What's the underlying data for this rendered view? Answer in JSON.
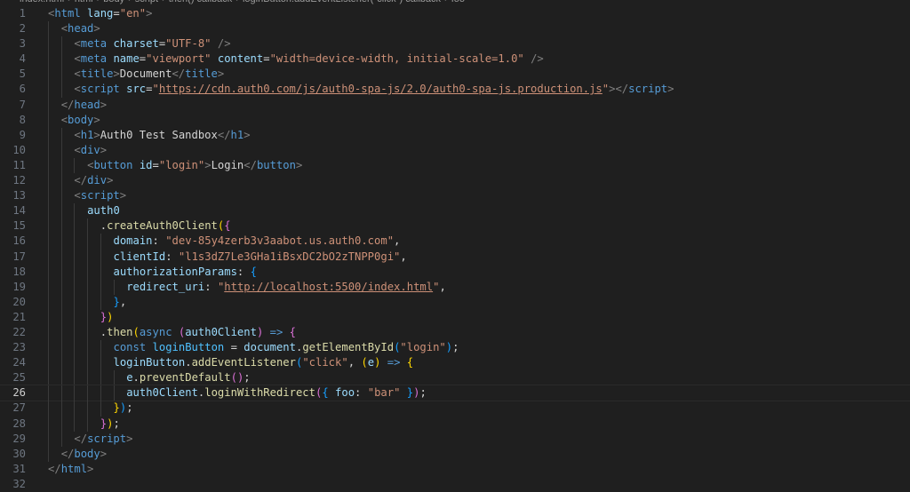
{
  "breadcrumb": [
    "index.html",
    "html",
    "body",
    "script",
    "then() callback",
    "loginButton.addEventListener(\"click\") callback",
    "foo"
  ],
  "active_line": 26,
  "lines": [
    {
      "n": "1",
      "indent": 0,
      "tokens": [
        [
          "ang",
          "<"
        ],
        [
          "tag",
          "html"
        ],
        [
          "text",
          " "
        ],
        [
          "attr",
          "lang"
        ],
        [
          "eq",
          "="
        ],
        [
          "str",
          "\"en\""
        ],
        [
          "ang",
          ">"
        ]
      ]
    },
    {
      "n": "2",
      "indent": 1,
      "tokens": [
        [
          "ang",
          "<"
        ],
        [
          "tag",
          "head"
        ],
        [
          "ang",
          ">"
        ]
      ]
    },
    {
      "n": "3",
      "indent": 2,
      "tokens": [
        [
          "ang",
          "<"
        ],
        [
          "tag",
          "meta"
        ],
        [
          "text",
          " "
        ],
        [
          "attr",
          "charset"
        ],
        [
          "eq",
          "="
        ],
        [
          "str",
          "\"UTF-8\""
        ],
        [
          "text",
          " "
        ],
        [
          "ang",
          "/>"
        ]
      ]
    },
    {
      "n": "4",
      "indent": 2,
      "tokens": [
        [
          "ang",
          "<"
        ],
        [
          "tag",
          "meta"
        ],
        [
          "text",
          " "
        ],
        [
          "attr",
          "name"
        ],
        [
          "eq",
          "="
        ],
        [
          "str",
          "\"viewport\""
        ],
        [
          "text",
          " "
        ],
        [
          "attr",
          "content"
        ],
        [
          "eq",
          "="
        ],
        [
          "str",
          "\"width=device-width, initial-scale=1.0\""
        ],
        [
          "text",
          " "
        ],
        [
          "ang",
          "/>"
        ]
      ]
    },
    {
      "n": "5",
      "indent": 2,
      "tokens": [
        [
          "ang",
          "<"
        ],
        [
          "tag",
          "title"
        ],
        [
          "ang",
          ">"
        ],
        [
          "text",
          "Document"
        ],
        [
          "ang",
          "</"
        ],
        [
          "tag",
          "title"
        ],
        [
          "ang",
          ">"
        ]
      ]
    },
    {
      "n": "6",
      "indent": 2,
      "tokens": [
        [
          "ang",
          "<"
        ],
        [
          "tag",
          "script"
        ],
        [
          "text",
          " "
        ],
        [
          "attr",
          "src"
        ],
        [
          "eq",
          "="
        ],
        [
          "str",
          "\""
        ],
        [
          "link",
          "https://cdn.auth0.com/js/auth0-spa-js/2.0/auth0-spa-js.production.js"
        ],
        [
          "str",
          "\""
        ],
        [
          "ang",
          "></"
        ],
        [
          "tag",
          "script"
        ],
        [
          "ang",
          ">"
        ]
      ]
    },
    {
      "n": "7",
      "indent": 1,
      "tokens": [
        [
          "ang",
          "</"
        ],
        [
          "tag",
          "head"
        ],
        [
          "ang",
          ">"
        ]
      ]
    },
    {
      "n": "8",
      "indent": 1,
      "tokens": [
        [
          "ang",
          "<"
        ],
        [
          "tag",
          "body"
        ],
        [
          "ang",
          ">"
        ]
      ]
    },
    {
      "n": "9",
      "indent": 2,
      "tokens": [
        [
          "ang",
          "<"
        ],
        [
          "tag",
          "h1"
        ],
        [
          "ang",
          ">"
        ],
        [
          "text",
          "Auth0 Test Sandbox"
        ],
        [
          "ang",
          "</"
        ],
        [
          "tag",
          "h1"
        ],
        [
          "ang",
          ">"
        ]
      ]
    },
    {
      "n": "10",
      "indent": 2,
      "tokens": [
        [
          "ang",
          "<"
        ],
        [
          "tag",
          "div"
        ],
        [
          "ang",
          ">"
        ]
      ]
    },
    {
      "n": "11",
      "indent": 3,
      "tokens": [
        [
          "ang",
          "<"
        ],
        [
          "tag",
          "button"
        ],
        [
          "text",
          " "
        ],
        [
          "attr",
          "id"
        ],
        [
          "eq",
          "="
        ],
        [
          "str",
          "\"login\""
        ],
        [
          "ang",
          ">"
        ],
        [
          "text",
          "Login"
        ],
        [
          "ang",
          "</"
        ],
        [
          "tag",
          "button"
        ],
        [
          "ang",
          ">"
        ]
      ]
    },
    {
      "n": "12",
      "indent": 2,
      "tokens": [
        [
          "ang",
          "</"
        ],
        [
          "tag",
          "div"
        ],
        [
          "ang",
          ">"
        ]
      ]
    },
    {
      "n": "13",
      "indent": 2,
      "tokens": [
        [
          "ang",
          "<"
        ],
        [
          "tag",
          "script"
        ],
        [
          "ang",
          ">"
        ]
      ]
    },
    {
      "n": "14",
      "indent": 3,
      "tokens": [
        [
          "var",
          "auth0"
        ]
      ]
    },
    {
      "n": "15",
      "indent": 4,
      "tokens": [
        [
          "punc",
          "."
        ],
        [
          "fn",
          "createAuth0Client"
        ],
        [
          "b1",
          "("
        ],
        [
          "b2",
          "{"
        ]
      ]
    },
    {
      "n": "16",
      "indent": 5,
      "tokens": [
        [
          "var",
          "domain"
        ],
        [
          "punc",
          ": "
        ],
        [
          "str",
          "\"dev-85y4zerb3v3aabot.us.auth0.com\""
        ],
        [
          "punc",
          ","
        ]
      ]
    },
    {
      "n": "17",
      "indent": 5,
      "tokens": [
        [
          "var",
          "clientId"
        ],
        [
          "punc",
          ": "
        ],
        [
          "str",
          "\"l1s3dZ7Le3GHa1iBsxDC2bO2zTNPP0gi\""
        ],
        [
          "punc",
          ","
        ]
      ]
    },
    {
      "n": "18",
      "indent": 5,
      "tokens": [
        [
          "var",
          "authorizationParams"
        ],
        [
          "punc",
          ": "
        ],
        [
          "b3",
          "{"
        ]
      ]
    },
    {
      "n": "19",
      "indent": 6,
      "tokens": [
        [
          "var",
          "redirect_uri"
        ],
        [
          "punc",
          ": "
        ],
        [
          "str",
          "\""
        ],
        [
          "link",
          "http://localhost:5500/index.html"
        ],
        [
          "str",
          "\""
        ],
        [
          "punc",
          ","
        ]
      ]
    },
    {
      "n": "20",
      "indent": 5,
      "tokens": [
        [
          "b3",
          "}"
        ],
        [
          "punc",
          ","
        ]
      ]
    },
    {
      "n": "21",
      "indent": 4,
      "tokens": [
        [
          "b2",
          "}"
        ],
        [
          "b1",
          ")"
        ]
      ]
    },
    {
      "n": "22",
      "indent": 4,
      "tokens": [
        [
          "punc",
          "."
        ],
        [
          "fn",
          "then"
        ],
        [
          "b1",
          "("
        ],
        [
          "kw",
          "async"
        ],
        [
          "text",
          " "
        ],
        [
          "b2",
          "("
        ],
        [
          "var",
          "auth0Client"
        ],
        [
          "b2",
          ")"
        ],
        [
          "text",
          " "
        ],
        [
          "kw",
          "=>"
        ],
        [
          "text",
          " "
        ],
        [
          "b2",
          "{"
        ]
      ]
    },
    {
      "n": "23",
      "indent": 5,
      "tokens": [
        [
          "kw",
          "const"
        ],
        [
          "text",
          " "
        ],
        [
          "const",
          "loginButton"
        ],
        [
          "text",
          " "
        ],
        [
          "eq",
          "="
        ],
        [
          "text",
          " "
        ],
        [
          "var",
          "document"
        ],
        [
          "punc",
          "."
        ],
        [
          "fn",
          "getElementById"
        ],
        [
          "b3",
          "("
        ],
        [
          "str",
          "\"login\""
        ],
        [
          "b3",
          ")"
        ],
        [
          "punc",
          ";"
        ]
      ]
    },
    {
      "n": "24",
      "indent": 5,
      "tokens": [
        [
          "var",
          "loginButton"
        ],
        [
          "punc",
          "."
        ],
        [
          "fn",
          "addEventListener"
        ],
        [
          "b3",
          "("
        ],
        [
          "str",
          "\"click\""
        ],
        [
          "punc",
          ", "
        ],
        [
          "b1",
          "("
        ],
        [
          "var",
          "e"
        ],
        [
          "b1",
          ")"
        ],
        [
          "text",
          " "
        ],
        [
          "kw",
          "=>"
        ],
        [
          "text",
          " "
        ],
        [
          "b1",
          "{"
        ]
      ]
    },
    {
      "n": "25",
      "indent": 6,
      "tokens": [
        [
          "var",
          "e"
        ],
        [
          "punc",
          "."
        ],
        [
          "fn",
          "preventDefault"
        ],
        [
          "b2",
          "()"
        ],
        [
          "punc",
          ";"
        ]
      ]
    },
    {
      "n": "26",
      "indent": 6,
      "tokens": [
        [
          "var",
          "auth0Client"
        ],
        [
          "punc",
          "."
        ],
        [
          "fn",
          "loginWithRedirect"
        ],
        [
          "b2",
          "("
        ],
        [
          "b3",
          "{"
        ],
        [
          "text",
          " "
        ],
        [
          "var",
          "foo"
        ],
        [
          "punc",
          ": "
        ],
        [
          "str",
          "\"bar\""
        ],
        [
          "text",
          " "
        ],
        [
          "b3",
          "}"
        ],
        [
          "b2",
          ")"
        ],
        [
          "punc",
          ";"
        ]
      ]
    },
    {
      "n": "27",
      "indent": 5,
      "tokens": [
        [
          "b1",
          "}"
        ],
        [
          "b3",
          ")"
        ],
        [
          "punc",
          ";"
        ]
      ]
    },
    {
      "n": "28",
      "indent": 4,
      "tokens": [
        [
          "b2",
          "}"
        ],
        [
          "b1",
          ")"
        ],
        [
          "punc",
          ";"
        ]
      ]
    },
    {
      "n": "29",
      "indent": 2,
      "tokens": [
        [
          "ang",
          "</"
        ],
        [
          "tag",
          "script"
        ],
        [
          "ang",
          ">"
        ]
      ]
    },
    {
      "n": "30",
      "indent": 1,
      "tokens": [
        [
          "ang",
          "</"
        ],
        [
          "tag",
          "body"
        ],
        [
          "ang",
          ">"
        ]
      ]
    },
    {
      "n": "31",
      "indent": 0,
      "tokens": [
        [
          "ang",
          "</"
        ],
        [
          "tag",
          "html"
        ],
        [
          "ang",
          ">"
        ]
      ]
    },
    {
      "n": "32",
      "indent": 0,
      "tokens": []
    }
  ]
}
